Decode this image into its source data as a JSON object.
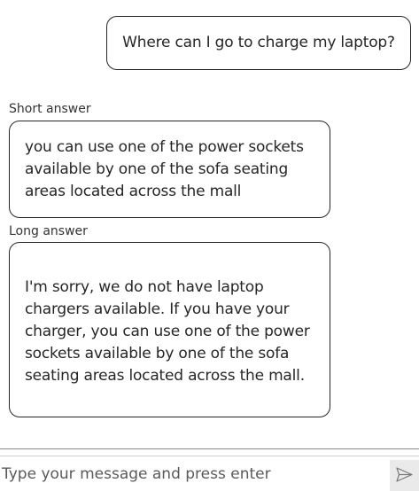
{
  "conversation": {
    "user_message": "Where can I go to charge my laptop?",
    "short_answer": {
      "label": "Short answer",
      "text": "you can use one of the power sockets available by one of the sofa seating areas located across the mall"
    },
    "long_answer": {
      "label": "Long answer",
      "text": "I'm sorry, we do not have laptop chargers available. If you have your charger, you can use one of the power sockets available by one of the sofa seating areas located across the mall."
    }
  },
  "composer": {
    "input_value": "",
    "placeholder": "Type your message and press enter",
    "send_icon": "send-icon"
  }
}
